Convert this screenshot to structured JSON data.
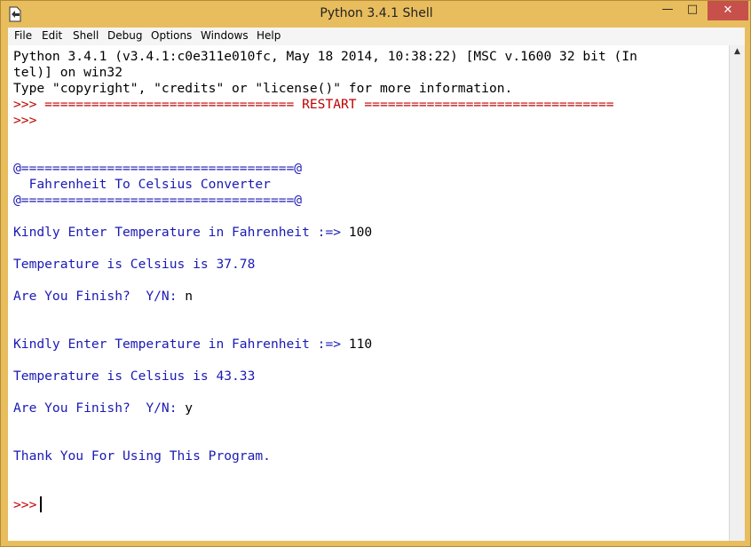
{
  "window": {
    "title": "Python 3.4.1 Shell",
    "controls": {
      "minimize": "—",
      "maximize": "□",
      "close": "✕"
    },
    "icon": "python-idle-icon"
  },
  "menubar": [
    "File",
    "Edit",
    "Shell",
    "Debug",
    "Options",
    "Windows",
    "Help"
  ],
  "console": {
    "header_line1": "Python 3.4.1 (v3.4.1:c0e311e010fc, May 18 2014, 10:38:22) [MSC v.1600 32 bit (In",
    "header_line2": "tel)] on win32",
    "info_line": "Type \"copyright\", \"credits\" or \"license()\" for more information.",
    "restart_line": ">>> ================================ RESTART ================================",
    "prompt": ">>> ",
    "banner_top": "@===================================@",
    "banner_title": "  Fahrenheit To Celsius Converter",
    "banner_bottom": "@===================================@",
    "enter_prompt": "Kindly Enter Temperature in Fahrenheit :=> ",
    "input1": "100",
    "result1": "Temperature is Celsius is 37.78",
    "finish_prompt": "Are You Finish?  Y/N: ",
    "answer1": "n",
    "input2": "110",
    "result2": "Temperature is Celsius is 43.33",
    "answer2": "y",
    "thanks": "Thank You For Using This Program.",
    "final_prompt": ">>>"
  },
  "colors": {
    "prompt": "#c00000",
    "output": "#1a1ab5",
    "input": "#000000",
    "frame": "#e8bd5e",
    "close": "#c7504b"
  }
}
